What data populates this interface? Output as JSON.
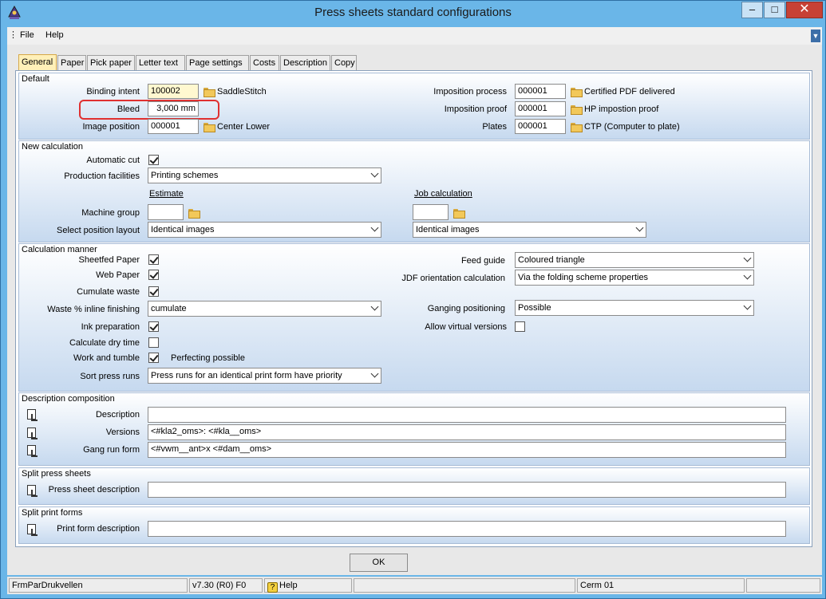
{
  "window": {
    "title": "Press sheets standard configurations"
  },
  "menu": {
    "file": "File",
    "help": "Help"
  },
  "tabs": [
    "General",
    "Paper",
    "Pick paper",
    "Letter text",
    "Page settings",
    "Costs",
    "Description",
    "Copy"
  ],
  "default": {
    "group_label": "Default",
    "binding_intent": {
      "label": "Binding intent",
      "value": "100002",
      "desc": "SaddleStitch"
    },
    "bleed": {
      "label": "Bleed",
      "value": "3,000 mm"
    },
    "image_position": {
      "label": "Image position",
      "value": "000001",
      "desc": "Center Lower"
    },
    "imposition_process": {
      "label": "Imposition process",
      "value": "000001",
      "desc": "Certified PDF delivered"
    },
    "imposition_proof": {
      "label": "Imposition proof",
      "value": "000001",
      "desc": "HP impostion proof"
    },
    "plates": {
      "label": "Plates",
      "value": "000001",
      "desc": "CTP (Computer to plate)"
    }
  },
  "new_calc": {
    "group_label": "New calculation",
    "automatic_cut": "Automatic cut",
    "production_facilities": {
      "label": "Production facilities",
      "value": "Printing schemes"
    },
    "estimate": "Estimate",
    "job_calculation": "Job calculation",
    "machine_group": "Machine group",
    "select_position_layout": "Select position layout",
    "layout_estimate": "Identical images",
    "layout_job": "Identical images"
  },
  "calc_manner": {
    "group_label": "Calculation manner",
    "sheetfed_paper": "Sheetfed Paper",
    "web_paper": "Web Paper",
    "cumulate_waste": "Cumulate waste",
    "waste_inline": {
      "label": "Waste % inline finishing",
      "value": "cumulate"
    },
    "ink_preparation": "Ink preparation",
    "calculate_dry_time": "Calculate dry time",
    "work_and_tumble": "Work and tumble",
    "perfecting_possible": "Perfecting possible",
    "sort_press_runs": {
      "label": "Sort press runs",
      "value": "Press runs for an identical print form have priority"
    },
    "feed_guide": {
      "label": "Feed guide",
      "value": "Coloured triangle"
    },
    "jdf_orientation": {
      "label": "JDF orientation calculation",
      "value": "Via the folding scheme properties"
    },
    "ganging_positioning": {
      "label": "Ganging positioning",
      "value": "Possible"
    },
    "allow_virtual_versions": "Allow virtual versions"
  },
  "desc_comp": {
    "group_label": "Description composition",
    "description": {
      "label": "Description",
      "value": ""
    },
    "versions": {
      "label": "Versions",
      "value": "<#kla2_oms>: <#kla__oms>"
    },
    "gang_run_form": {
      "label": "Gang run form",
      "value": "<#vwm__ant>x <#dam__oms>"
    }
  },
  "split_press": {
    "group_label": "Split press sheets",
    "label": "Press sheet description",
    "value": ""
  },
  "split_print": {
    "group_label": "Split print forms",
    "label": "Print form description",
    "value": ""
  },
  "ok": "OK",
  "status": {
    "form": "FrmParDrukvellen",
    "version": "v7.30 (R0) F0",
    "help": "Help",
    "user": "Cerm 01"
  }
}
